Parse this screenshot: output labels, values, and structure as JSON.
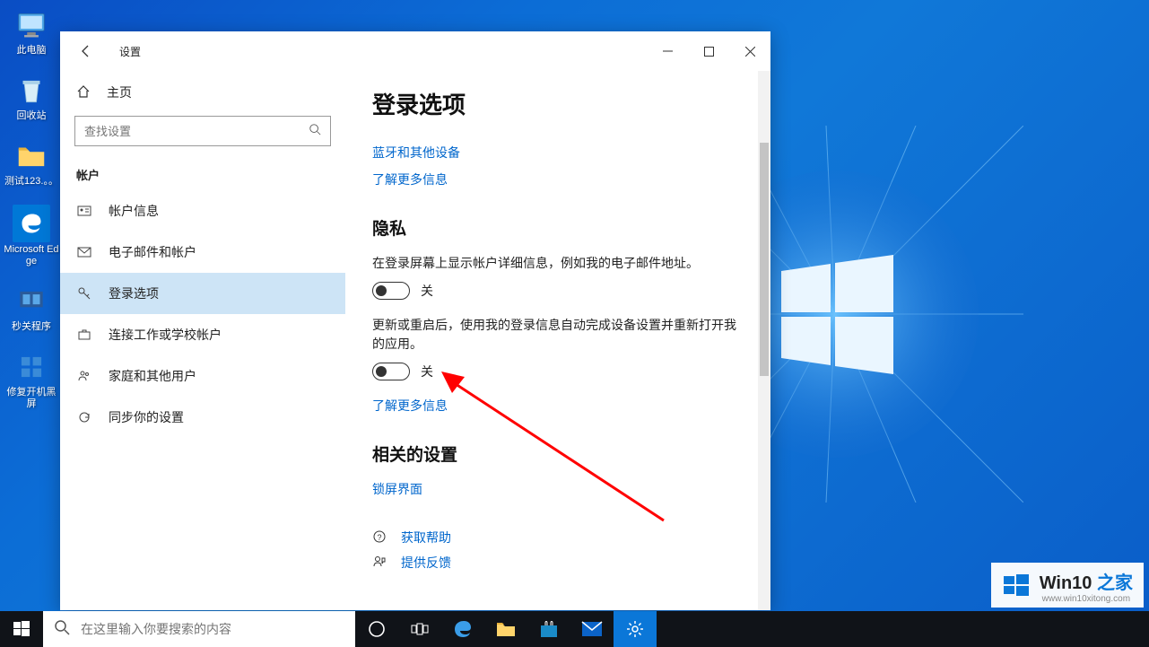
{
  "desktop": {
    "icons": [
      {
        "name": "this-pc",
        "label": "此电脑"
      },
      {
        "name": "recycle-bin",
        "label": "回收站"
      },
      {
        "name": "folder-test",
        "label": "测试123.。。"
      },
      {
        "name": "edge",
        "label": "Microsoft Edge"
      },
      {
        "name": "shutdown-app",
        "label": "秒关程序"
      },
      {
        "name": "repair-app",
        "label": "修复开机黑屏"
      }
    ]
  },
  "window": {
    "title": "设置",
    "home": "主页",
    "search_placeholder": "查找设置",
    "section": "帐户",
    "nav": [
      {
        "label": "帐户信息"
      },
      {
        "label": "电子邮件和帐户"
      },
      {
        "label": "登录选项"
      },
      {
        "label": "连接工作或学校帐户"
      },
      {
        "label": "家庭和其他用户"
      },
      {
        "label": "同步你的设置"
      }
    ]
  },
  "content": {
    "heading": "登录选项",
    "link1": "蓝牙和其他设备",
    "link2": "了解更多信息",
    "privacy_h": "隐私",
    "priv1_desc": "在登录屏幕上显示帐户详细信息，例如我的电子邮件地址。",
    "priv1_state": "关",
    "priv2_desc": "更新或重启后，使用我的登录信息自动完成设备设置并重新打开我的应用。",
    "priv2_state": "关",
    "link3": "了解更多信息",
    "related_h": "相关的设置",
    "link4": "锁屏界面",
    "help1": "获取帮助",
    "help2": "提供反馈"
  },
  "taskbar": {
    "search_placeholder": "在这里输入你要搜索的内容"
  },
  "watermark": {
    "main_a": "Win10",
    "main_b": "之家",
    "sub": "www.win10xitong.com"
  }
}
